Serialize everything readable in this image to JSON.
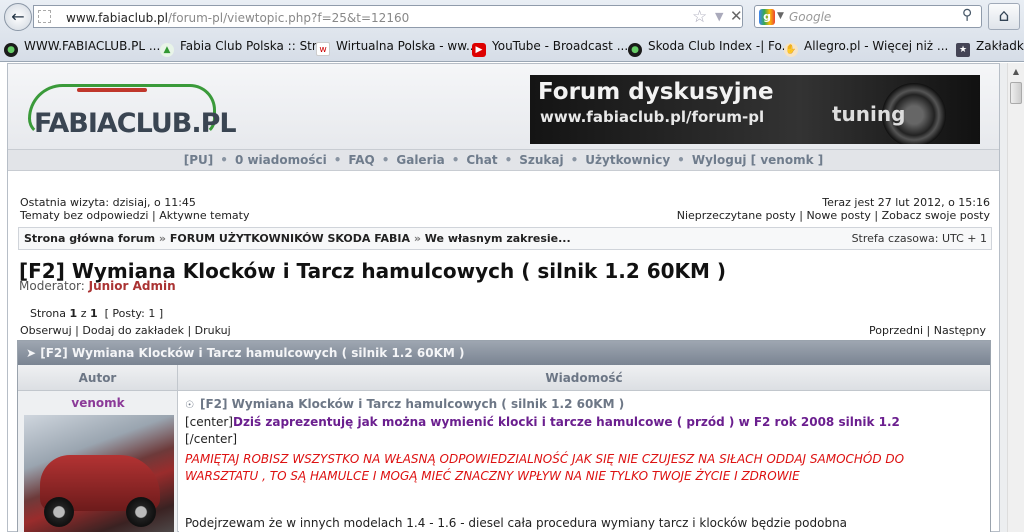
{
  "browser": {
    "url_host": "www.fabiaclub.pl",
    "url_path": "/forum-pl/viewtopic.php?f=25&t=12160",
    "search_placeholder": "Google",
    "bookmarks": [
      "WWW.FABIACLUB.PL ...",
      "Fabia Club Polska :: Str...",
      "Wirtualna Polska - ww...",
      "YouTube - Broadcast ...",
      "Skoda Club Index -| Fo...",
      "Allegro.pl - Więcej niż ...",
      "Zakładki"
    ]
  },
  "header": {
    "logo_text": "FABIACLUB.PL",
    "banner_line1": "Forum dyskusyjne",
    "banner_line2": "www.fabiaclub.pl/forum-pl",
    "banner_tuning": "tuning"
  },
  "nav": {
    "pu": "[PU]",
    "messages": "0 wiadomości",
    "faq": "FAQ",
    "gallery": "Galeria",
    "chat": "Chat",
    "search": "Szukaj",
    "users": "Użytkownicy",
    "logout": "Wyloguj [ venomk ]"
  },
  "info": {
    "last_visit": "Ostatnia wizyta: dzisiaj, o 11:45",
    "now": "Teraz jest 27 lut 2012, o 15:16",
    "unanswered": "Tematy bez odpowiedzi",
    "active": "Aktywne tematy",
    "unread": "Nieprzeczytane posty",
    "new_posts": "Nowe posty",
    "own_posts": "Zobacz swoje posty"
  },
  "breadcrumb": {
    "home": "Strona główna forum",
    "forum": "FORUM UŻYTKOWNIKÓW SKODA FABIA",
    "subforum": "We własnym zakresie...",
    "sep": "»",
    "timezone": "Strefa czasowa: UTC + 1"
  },
  "topic": {
    "title": "[F2] Wymiana Klocków i Tarcz hamulcowych ( silnik 1.2 60KM )",
    "moderator_label": "Moderator:",
    "moderator_name": "Junior Admin",
    "page_label": "Strona",
    "page_current": "1",
    "page_of": "z",
    "page_total": "1",
    "posts_count": "[ Posty: 1 ]",
    "observe": "Obserwuj",
    "bookmark": "Dodaj do zakładek",
    "print": "Drukuj",
    "prev": "Poprzedni",
    "next": "Następny"
  },
  "thread": {
    "header": "[F2] Wymiana Klocków i Tarcz hamulcowych ( silnik 1.2 60KM )",
    "col_author": "Autor",
    "col_message": "Wiadomość"
  },
  "post": {
    "author": "venomk",
    "title": "[F2] Wymiana Klocków i Tarcz hamulcowych ( silnik 1.2 60KM )",
    "center_open": "[center]",
    "intro_bold": "Dziś zaprezentuję jak można wymienić klocki i tarcze hamulcowe ( przód ) w F2 rok 2008 silnik 1.2",
    "center_close": "[/center]",
    "warning": "PAMIĘTAJ ROBISZ WSZYSTKO NA WŁASNĄ ODPOWIEDZIALNOŚĆ JAK SIĘ NIE CZUJESZ NA SIŁACH ODDAJ SAMOCHÓD DO WARSZTATU , TO SĄ HAMULCE I MOGĄ MIEĆ ZNACZNY WPŁYW NA NIE TYLKO TWOJE ŻYCIE I ZDROWIE",
    "body_line": "Podejrzewam że w innych modelach 1.4 - 1.6 - diesel cała procedura wymiany tarcz i klocków będzie podobna"
  }
}
